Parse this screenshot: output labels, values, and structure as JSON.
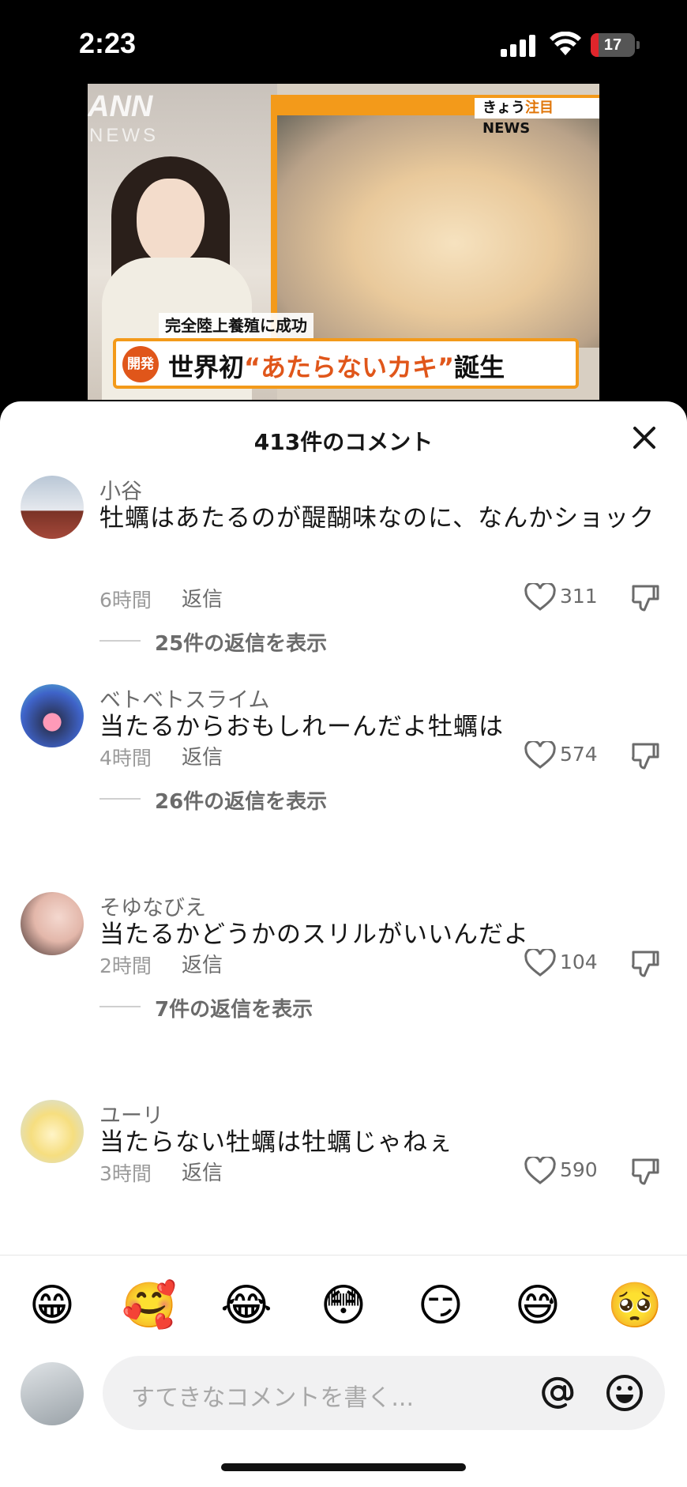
{
  "status_bar": {
    "time": "2:23",
    "battery": "17",
    "battery_level": 0.17
  },
  "video": {
    "logo": "ANN",
    "logo_sub": "NEWS",
    "tag_prefix": "きょう",
    "tag_highlight": "注目",
    "tag_suffix": "NEWS",
    "sub_caption": "完全陸上養殖に成功",
    "badge": "開発",
    "headline_prefix": "世界初",
    "headline_highlight": "“あたらないカキ”",
    "headline_suffix": "誕生"
  },
  "sheet": {
    "title": "413件のコメント",
    "close_icon": "close-icon"
  },
  "comments": [
    {
      "username": "小谷",
      "text": "牡蠣はあたるのが醍醐味なのに、なんかショック",
      "time": "6時間",
      "reply": "返信",
      "likes": "311",
      "view_replies": "25件の返信を表示"
    },
    {
      "username": "ベトベトスライム",
      "text": "当たるからおもしれーんだよ牡蠣は",
      "time": "4時間",
      "reply": "返信",
      "likes": "574",
      "view_replies": "26件の返信を表示"
    },
    {
      "username": "そゆなびえ",
      "text": "当たるかどうかのスリルがいいんだよ",
      "time": "2時間",
      "reply": "返信",
      "likes": "104",
      "view_replies": "7件の返信を表示"
    },
    {
      "username": "ユーリ",
      "text": "当たらない牡蠣は牡蠣じゃねぇ",
      "time": "3時間",
      "reply": "返信",
      "likes": "590"
    }
  ],
  "emojis": [
    "😁",
    "🥰",
    "😂",
    "😳",
    "😏",
    "😅",
    "🥺"
  ],
  "composer": {
    "placeholder": "すてきなコメントを書く...",
    "at_icon": "at-icon",
    "emoji_icon": "emoji-icon"
  },
  "colors": {
    "accent_orange": "#f39a1a",
    "headline_red": "#e0561a",
    "battery_red": "#e0252b"
  }
}
